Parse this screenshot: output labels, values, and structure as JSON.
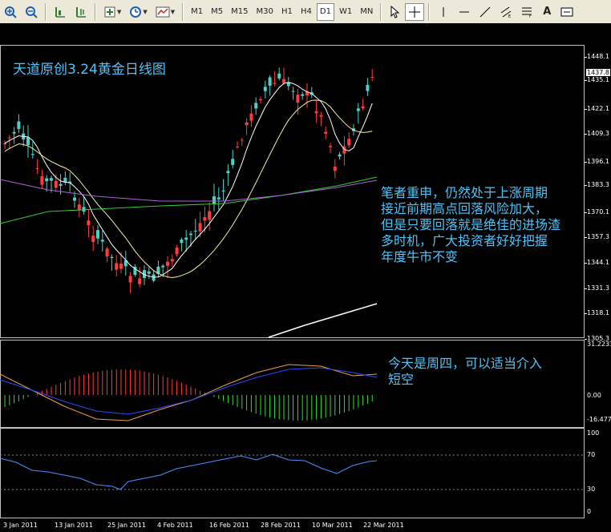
{
  "toolbar": {
    "timeframes": [
      "M1",
      "M5",
      "M15",
      "M30",
      "H1",
      "H4",
      "D1",
      "W1",
      "MN"
    ],
    "active_timeframe": "D1",
    "text_tool": "A"
  },
  "chart": {
    "title_note": "天道原创3.24黄金日线图",
    "main_note": "笔者重申，仍然处于上涨周期\n接近前期高点回落风险加大，\n但是只要回落就是绝佳的进场渣\n多时机，广大投资者好好把握\n年度牛市不变",
    "macd_note": "今天是周四，可以适当介入\n短空",
    "current_price": "1437.8",
    "price_axis": [
      "1448.1",
      "1435.1",
      "1422.1",
      "1409.3",
      "1396.1",
      "1383.3",
      "1370.1",
      "1357.3",
      "1344.1",
      "1331.3",
      "1318.1",
      "1305.3"
    ],
    "macd_axis": [
      "31.2233",
      "0.00",
      "-16.477"
    ],
    "rsi_axis": [
      "100",
      "70",
      "30",
      "0"
    ],
    "dates": [
      "3 Jan 2011",
      "13 Jan 2011",
      "25 Jan 2011",
      "4 Feb 2011",
      "16 Feb 2011",
      "28 Feb 2011",
      "10 Mar 2011",
      "22 Mar 2011"
    ],
    "colors": {
      "bull": "#ff3b3b",
      "bear": "#4dd0c8",
      "ma_fast": "#ffffff",
      "ma_mid": "#f5f0a0",
      "ma_slow": "#33cc33",
      "ma_long": "#b060e0",
      "rsi": "#4a90ff"
    }
  }
}
